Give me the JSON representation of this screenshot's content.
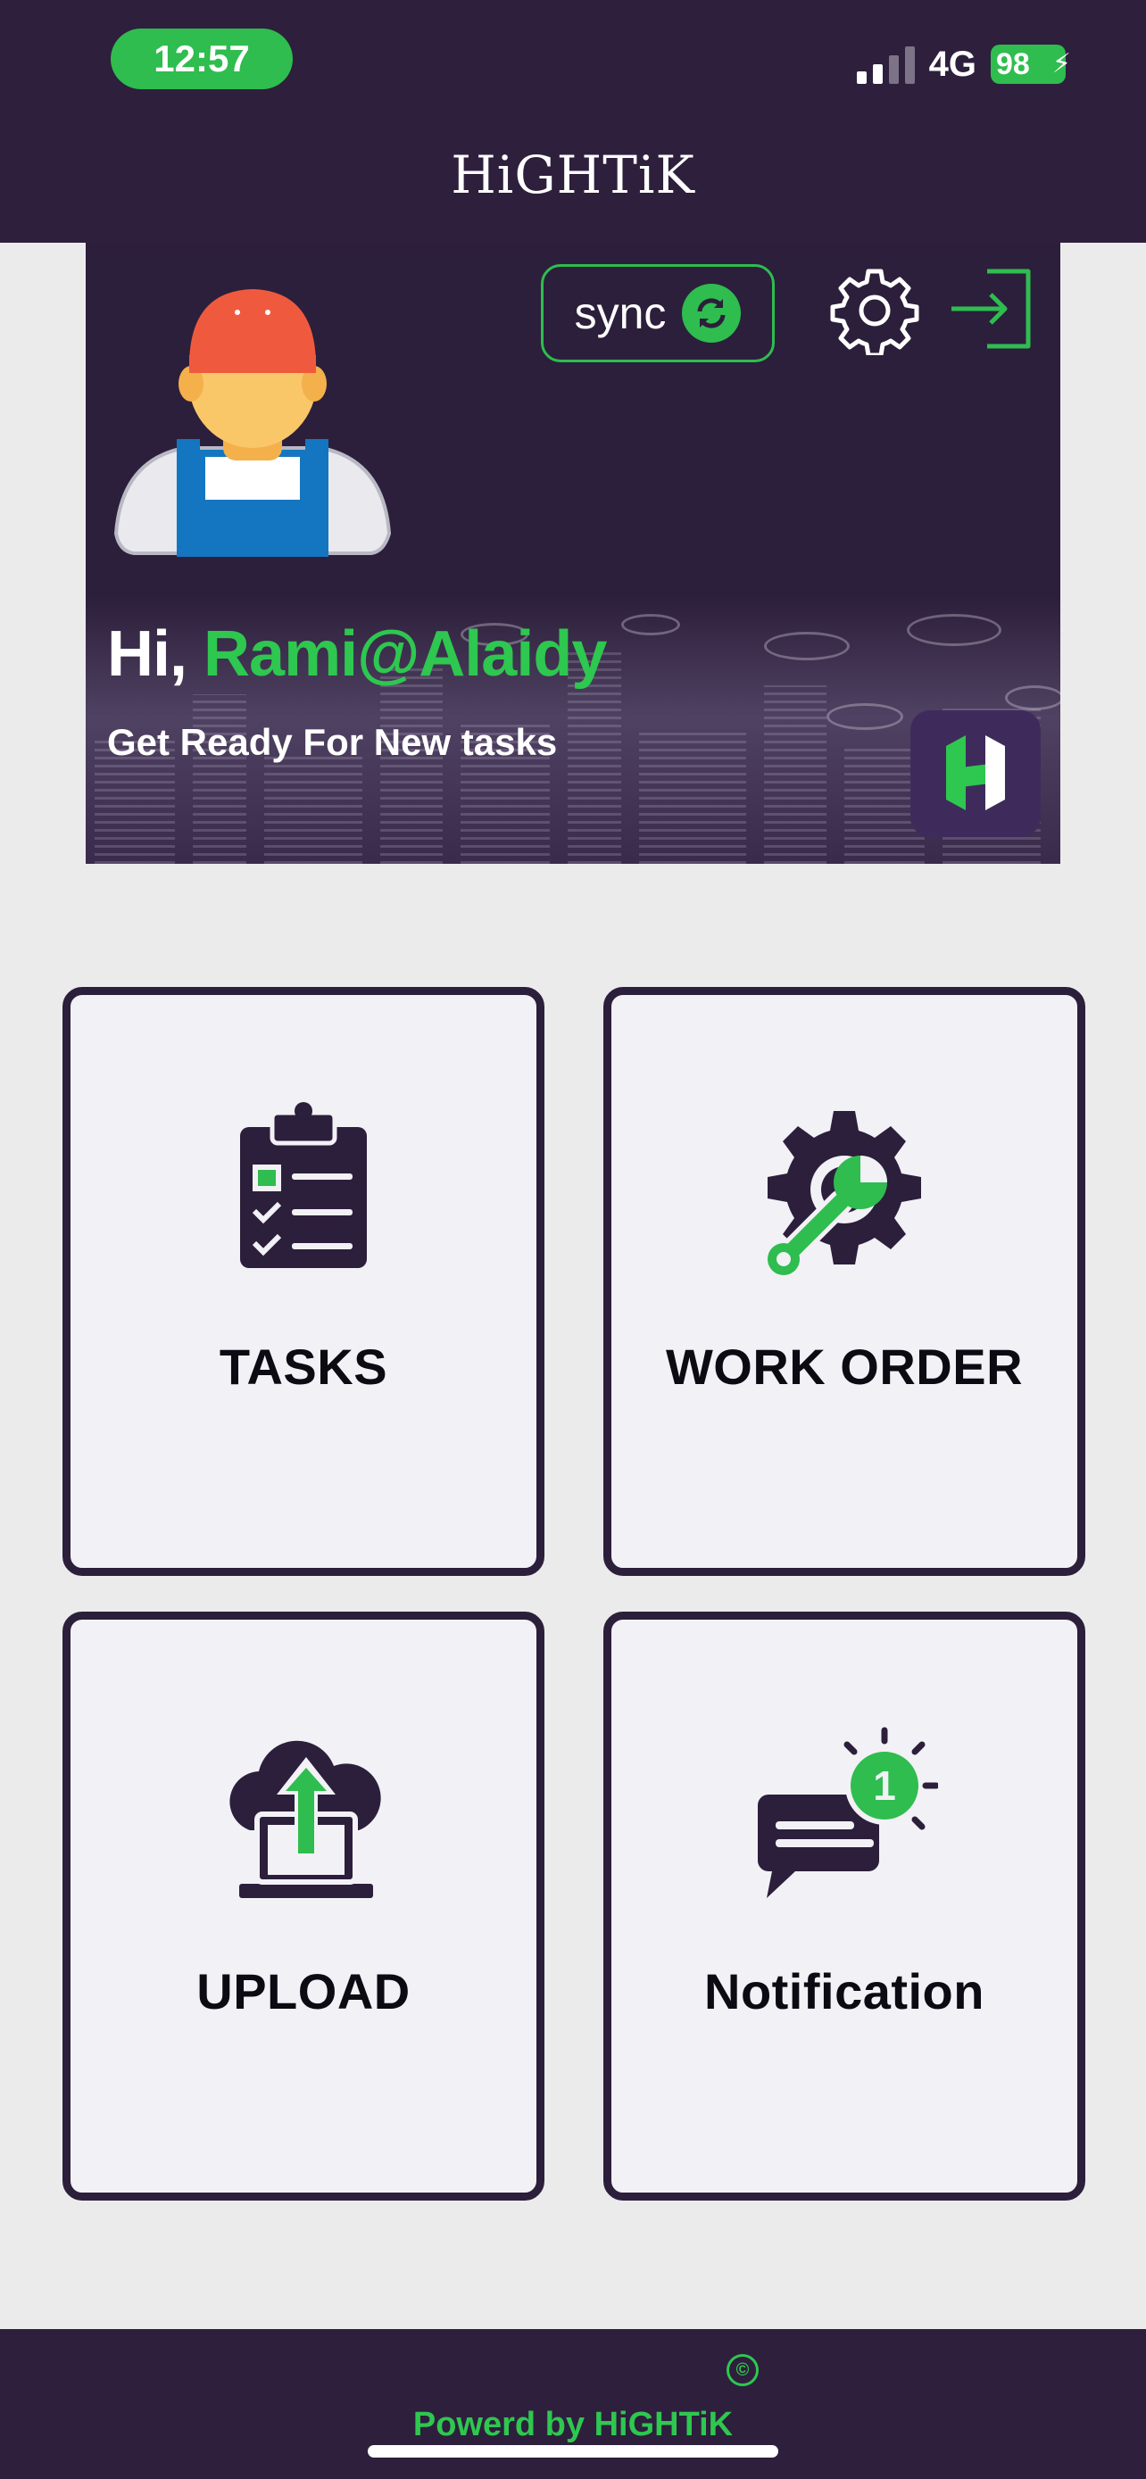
{
  "status_bar": {
    "time": "12:57",
    "network": "4G",
    "battery": "98"
  },
  "header": {
    "title": "HiGHTiK"
  },
  "hero": {
    "sync_label": "sync",
    "greeting": "Hi,",
    "username": "Rami@Alaidy",
    "subtitle": "Get Ready For New tasks"
  },
  "menu": {
    "tasks": "TASKS",
    "work_order": "WORK ORDER",
    "upload": "UPLOAD",
    "notification": "Notification",
    "notification_count": "1"
  },
  "footer": {
    "powered": "Powerd by HiGHTiK",
    "copyright_symbol": "©"
  },
  "colors": {
    "brand_dark": "#2c1f3b",
    "accent_green": "#2ebd4e",
    "background": "#ebebec"
  }
}
